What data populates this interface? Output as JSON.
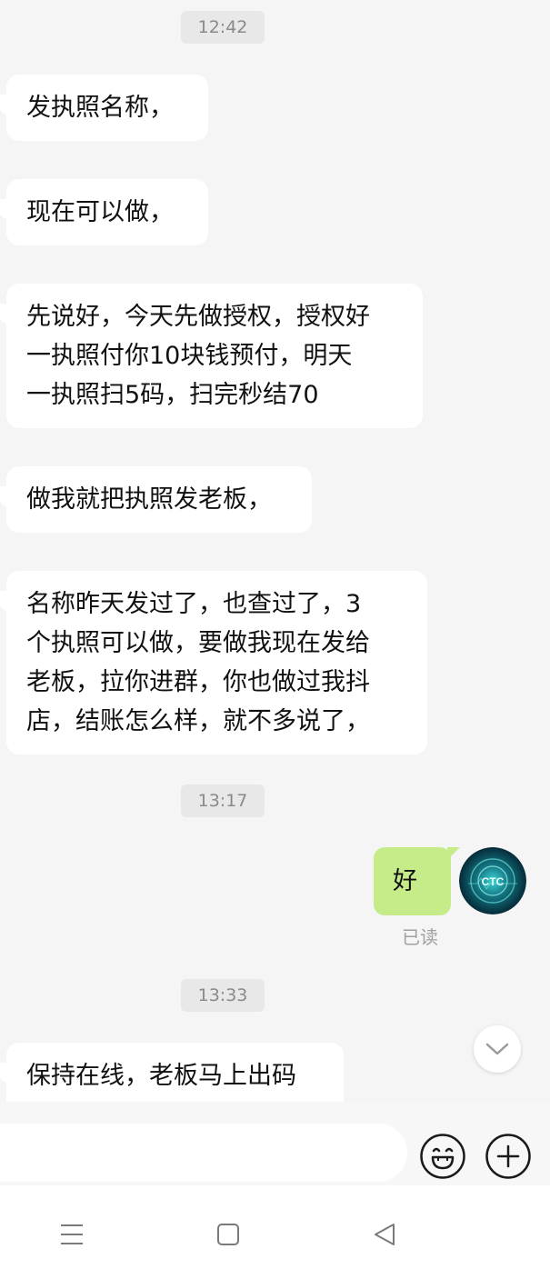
{
  "messages": {
    "ts1": "12:42",
    "m1": "发执照名称，",
    "m2": "现在可以做，",
    "m3": "先说好，今天先做授权，授权好\n一执照付你10块钱预付，明天\n一执照扫5码，扫完秒结70",
    "m4": "做我就把执照发老板，",
    "m5": "名称昨天发过了，也查过了，3\n个执照可以做，要做我现在发给\n老板，拉你进群，你也做过我抖\n店，结账怎么样，就不多说了，",
    "ts2": "13:17",
    "out1": "好",
    "read_status": "已读",
    "ts3": "13:33",
    "m6": "保持在线，老板马上出码"
  },
  "avatar_text": "CTC",
  "colors": {
    "background": "#f5f5f5",
    "incoming_bubble": "#ffffff",
    "outgoing_bubble": "#c6ec8a",
    "timestamp_bg": "#e8e8e8"
  },
  "icons": {
    "emoji": "smiley-face-icon",
    "add": "plus-circle-icon",
    "scroll": "chevron-down-icon",
    "nav_menu": "menu-icon",
    "nav_home": "square-icon",
    "nav_back": "back-triangle-icon"
  }
}
